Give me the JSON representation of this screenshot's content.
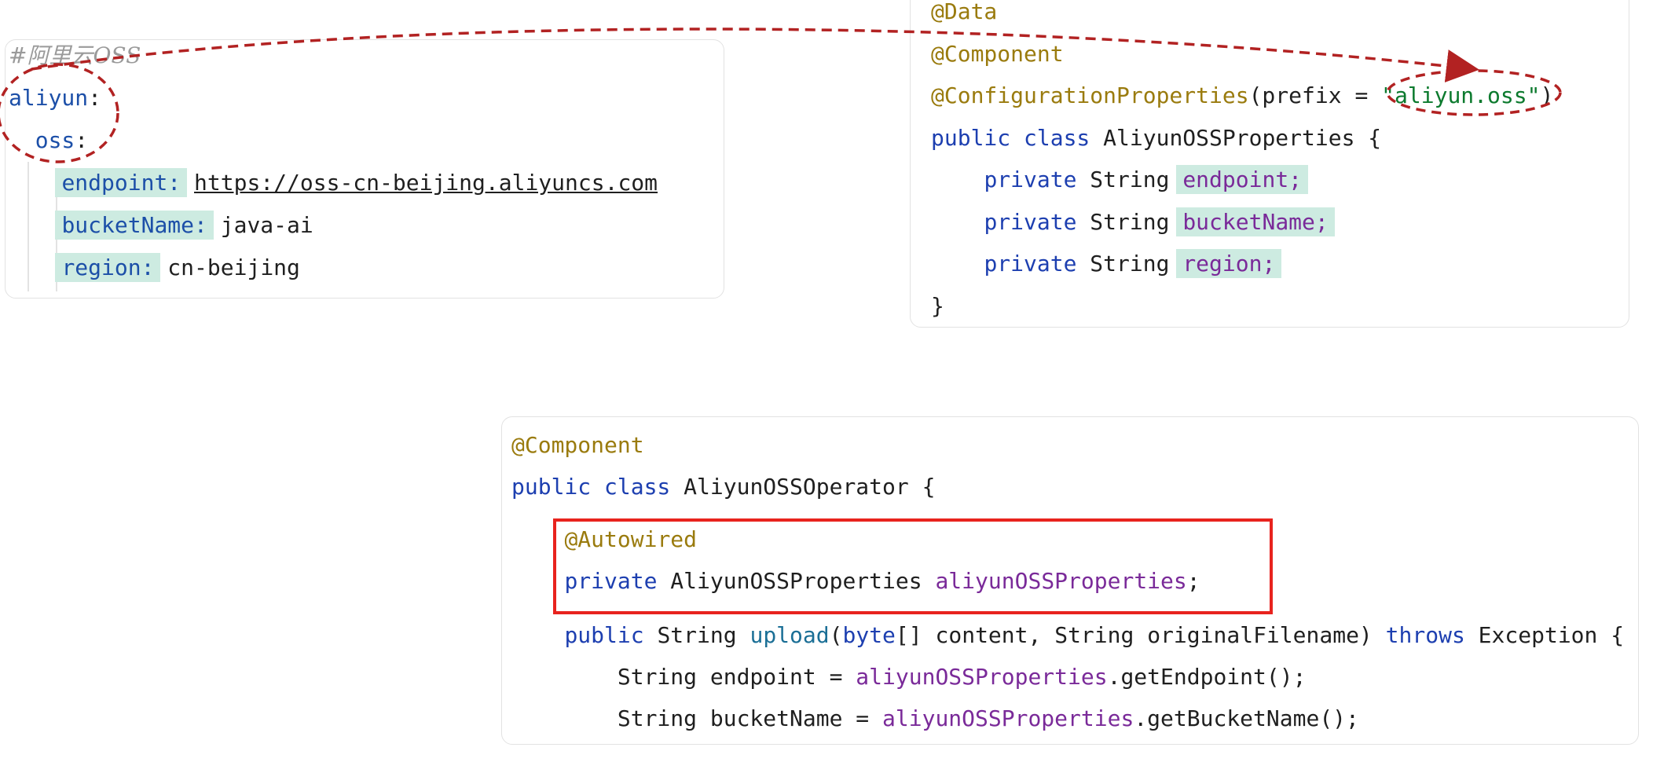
{
  "yaml_panel": {
    "lines": [
      [
        {
          "t": "#阿里云OSS",
          "c": "comment"
        }
      ],
      [
        {
          "t": "aliyun",
          "c": "key"
        },
        {
          "t": ":",
          "c": "plain"
        }
      ],
      [
        {
          "t": "  "
        },
        {
          "t": "oss",
          "c": "key"
        },
        {
          "t": ":",
          "c": "plain"
        }
      ],
      [
        {
          "t": "    "
        },
        {
          "t": "endpoint:",
          "c": "key",
          "hl": true
        },
        {
          "t": " "
        },
        {
          "t": "https://oss-cn-beijing.aliyuncs.com",
          "c": "url"
        }
      ],
      [
        {
          "t": "    "
        },
        {
          "t": "bucketName:",
          "c": "key",
          "hl": true
        },
        {
          "t": " java-ai",
          "c": "plain"
        }
      ],
      [
        {
          "t": "    "
        },
        {
          "t": "region:",
          "c": "key",
          "hl": true
        },
        {
          "t": " cn-beijing",
          "c": "plain"
        }
      ]
    ]
  },
  "properties_panel": {
    "lines": [
      [
        {
          "t": "@Data",
          "c": "ann"
        }
      ],
      [
        {
          "t": "@Component",
          "c": "ann"
        }
      ],
      [
        {
          "t": "@ConfigurationProperties",
          "c": "ann"
        },
        {
          "t": "(prefix = ",
          "c": "plain"
        },
        {
          "t": "\"aliyun.oss\"",
          "c": "str"
        },
        {
          "t": ")",
          "c": "plain"
        }
      ],
      [
        {
          "t": "public class ",
          "c": "kw"
        },
        {
          "t": "AliyunOSSProperties {",
          "c": "plain"
        }
      ],
      [
        {
          "t": "    "
        },
        {
          "t": "private ",
          "c": "kw"
        },
        {
          "t": "String ",
          "c": "plain"
        },
        {
          "t": "endpoint;",
          "c": "field",
          "hl": true
        }
      ],
      [
        {
          "t": "    "
        },
        {
          "t": "private ",
          "c": "kw"
        },
        {
          "t": "String ",
          "c": "plain"
        },
        {
          "t": "bucketName;",
          "c": "field",
          "hl": true
        }
      ],
      [
        {
          "t": "    "
        },
        {
          "t": "private ",
          "c": "kw"
        },
        {
          "t": "String ",
          "c": "plain"
        },
        {
          "t": "region;",
          "c": "field",
          "hl": true
        }
      ],
      [
        {
          "t": "}",
          "c": "plain"
        }
      ]
    ]
  },
  "operator_panel": {
    "lines": [
      [
        {
          "t": "@Component",
          "c": "ann"
        }
      ],
      [
        {
          "t": "public class ",
          "c": "kw"
        },
        {
          "t": "AliyunOSSOperator {",
          "c": "plain"
        }
      ],
      [
        {
          "t": "    "
        },
        {
          "t": "@Autowired",
          "c": "ann"
        }
      ],
      [
        {
          "t": "    "
        },
        {
          "t": "private ",
          "c": "kw"
        },
        {
          "t": "AliyunOSSProperties ",
          "c": "plain"
        },
        {
          "t": "aliyunOSSProperties",
          "c": "field"
        },
        {
          "t": ";",
          "c": "plain"
        }
      ],
      [
        {
          "t": "    "
        },
        {
          "t": "public ",
          "c": "kw"
        },
        {
          "t": "String ",
          "c": "plain"
        },
        {
          "t": "upload",
          "c": "fn"
        },
        {
          "t": "(",
          "c": "plain"
        },
        {
          "t": "byte",
          "c": "kw"
        },
        {
          "t": "[] content, String originalFilename) ",
          "c": "plain"
        },
        {
          "t": "throws ",
          "c": "kw"
        },
        {
          "t": "Exception {",
          "c": "plain"
        }
      ],
      [
        {
          "t": "        "
        },
        {
          "t": "String endpoint = ",
          "c": "plain"
        },
        {
          "t": "aliyunOSSProperties",
          "c": "field"
        },
        {
          "t": ".getEndpoint();",
          "c": "plain"
        }
      ],
      [
        {
          "t": "        "
        },
        {
          "t": "String bucketName = ",
          "c": "plain"
        },
        {
          "t": "aliyunOSSProperties",
          "c": "field"
        },
        {
          "t": ".getBucketName();",
          "c": "plain"
        }
      ]
    ]
  },
  "colors": {
    "key": "#1c4fa8",
    "annotation": "#9a7b0e",
    "keyword": "#1d3fb0",
    "field": "#7a2a99",
    "string": "#0c7a2e",
    "highlight": "#cdebe1",
    "annotation_marks": "#b22222",
    "emphasis_box": "#e8231e"
  }
}
